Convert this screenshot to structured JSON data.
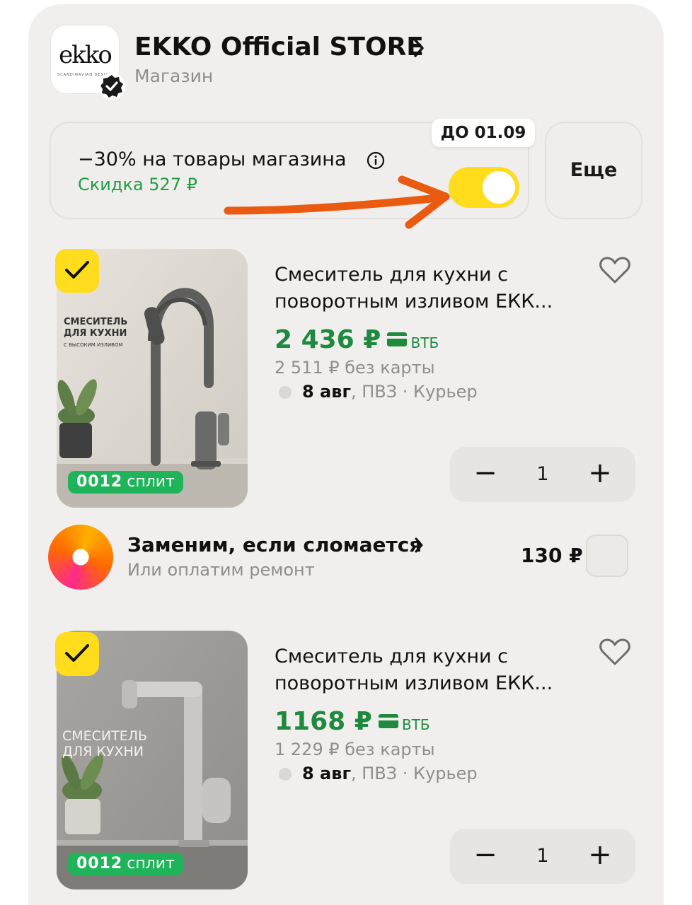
{
  "store": {
    "logo_text": "ekko",
    "logo_tagline": "SCANDINAVIAN DESIGN",
    "name": "EKKO Official STORE",
    "type": "Магазин"
  },
  "promo": {
    "title": "−30% на товары магазина",
    "discount": "Скидка 527 ₽",
    "deadline": "ДО 01.09",
    "toggle_on": true,
    "more_label": "Еще"
  },
  "products": [
    {
      "title_line1": "Смеситель для кухни с",
      "title_line2": "поворотным изливом ЕКК...",
      "price": "2 436 ₽",
      "bank": "ВТБ",
      "old_price": "2 511 ₽  без карты",
      "delivery_date": "8 авг",
      "delivery_rest": ", ПВЗ · Курьер",
      "quantity": "1",
      "split_digits": "0012",
      "split_label": "сплит",
      "image_text_1": "СМЕСИТЕЛЬ",
      "image_text_2": "ДЛЯ КУХНИ",
      "image_text_3": "С ВЫСОКИМ ИЗЛИВОМ",
      "minus": "−",
      "plus": "+"
    },
    {
      "title_line1": "Смеситель для кухни с",
      "title_line2": "поворотным изливом ЕКК...",
      "price": "1168 ₽",
      "bank": "ВТБ",
      "old_price": "1 229 ₽  без карты",
      "delivery_date": "8 авг",
      "delivery_rest": ", ПВЗ · Курьер",
      "quantity": "1",
      "split_digits": "0012",
      "split_label": "сплит",
      "image_text_1": "СМЕСИТЕЛЬ",
      "image_text_2": "ДЛЯ КУХНИ",
      "minus": "−",
      "plus": "+"
    }
  ],
  "protection": {
    "title": "Заменим, если сломается",
    "subtitle": "Или оплатим ремонт",
    "price": "130 ₽"
  },
  "colors": {
    "accent_yellow": "#ffdc1c",
    "price_green": "#1f8a3e",
    "arrow_orange": "#ea5a10"
  }
}
